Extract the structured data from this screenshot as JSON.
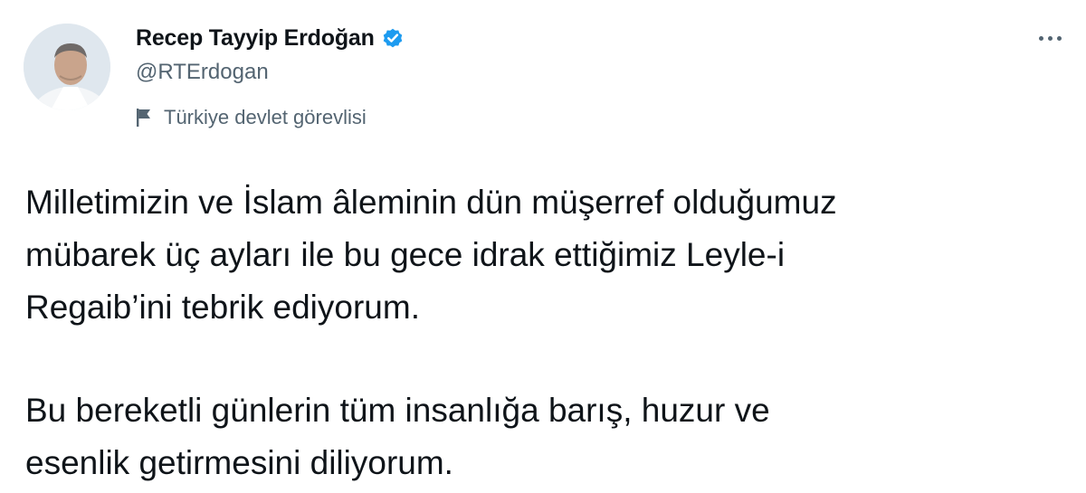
{
  "author": {
    "display_name": "Recep Tayyip Erdoğan",
    "handle": "@RTErdogan",
    "verified_icon": "verified-badge-icon",
    "account_label": "Türkiye devlet görevlisi",
    "label_icon": "flag-icon",
    "avatar_icon": "avatar-portrait"
  },
  "menu": {
    "more_icon": "more-options-icon"
  },
  "tweet": {
    "paragraphs": [
      {
        "lines": [
          "Milletimizin ve İslam âleminin dün müşerref olduğumuz",
          "mübarek üç ayları ile bu gece idrak ettiğimiz Leyle-i",
          "Regaib’ini tebrik ediyorum."
        ]
      },
      {
        "lines": [
          "Bu bereketli günlerin tüm insanlığa barış, huzur ve",
          "esenlik getirmesini diliyorum."
        ]
      }
    ]
  },
  "colors": {
    "primary_text": "#0f1419",
    "secondary_text": "#536471",
    "verified_blue": "#1d9bf0",
    "background": "#ffffff"
  }
}
